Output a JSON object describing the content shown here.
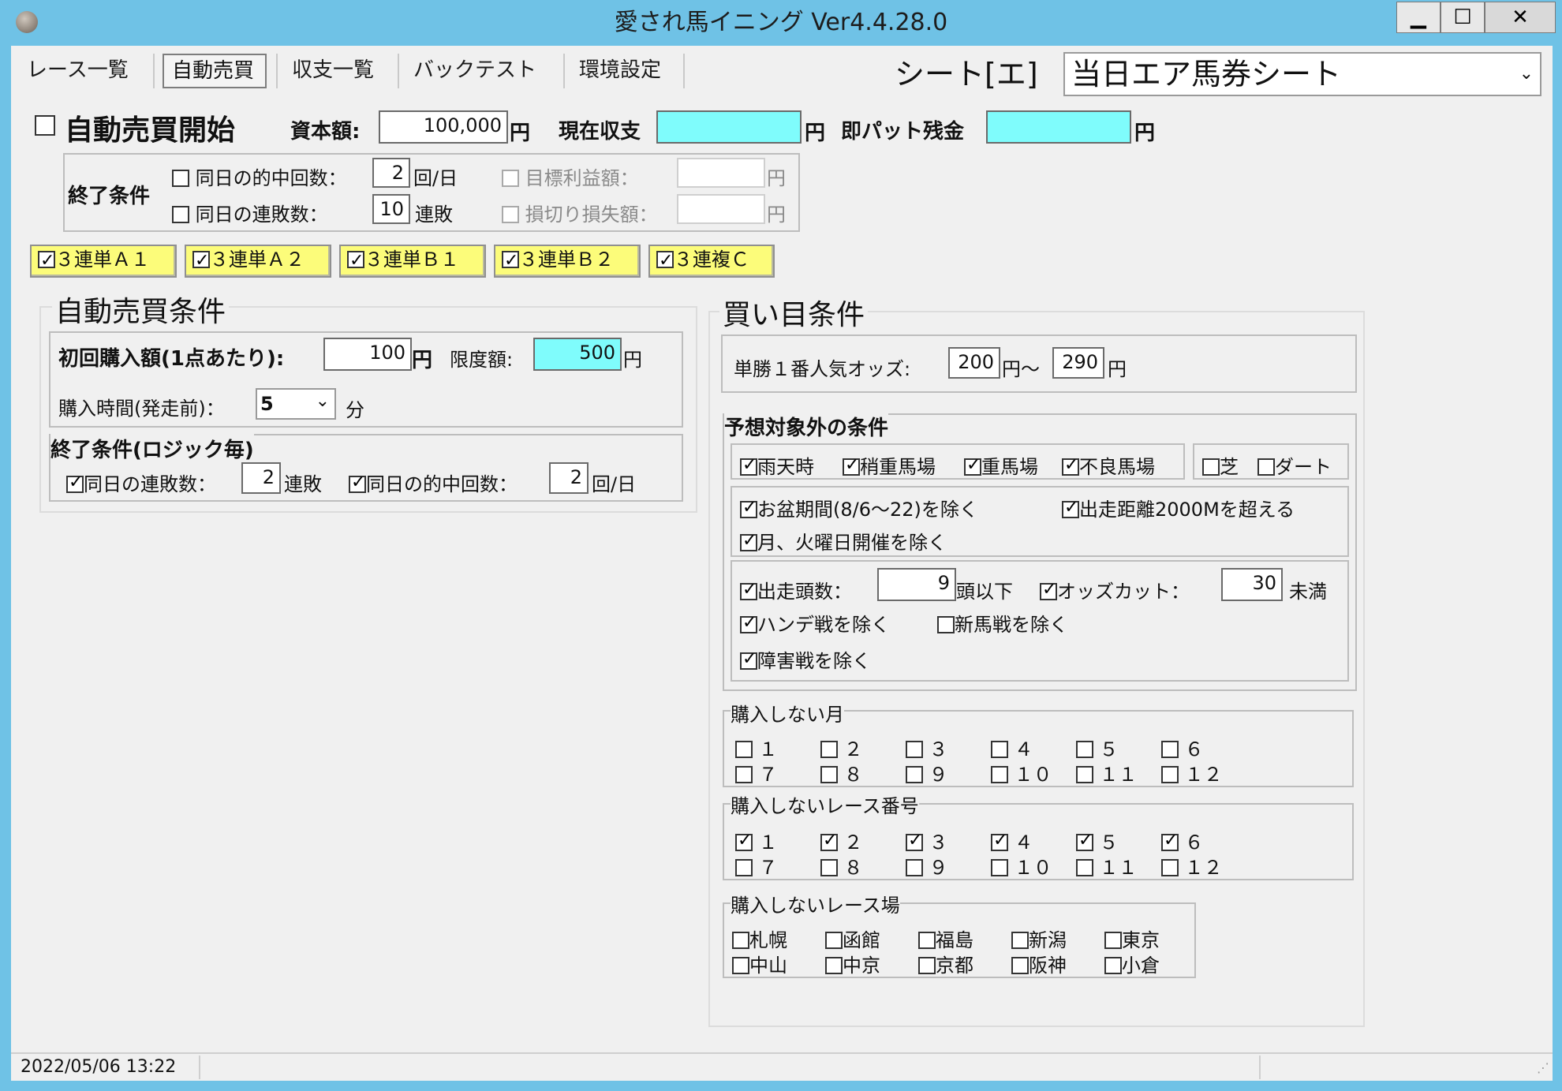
{
  "window": {
    "title": "愛され馬イニング Ver4.4.28.0",
    "minimize": "▁",
    "maximize": "☐",
    "close": "✕"
  },
  "menu": [
    "レース一覧",
    "自動売買",
    "収支一覧",
    "バックテスト",
    "環境設定"
  ],
  "sheet": {
    "label": "シート[エ]",
    "selected": "当日エア馬券シート"
  },
  "top": {
    "auto_start": "自動売買開始",
    "capital_label": "資本額:",
    "capital": "100,000",
    "yen": "円",
    "current_label": "現在収支",
    "current_value": "",
    "sokupat_label": "即パット残金",
    "sokupat_value": ""
  },
  "end_cond": {
    "title": "終了条件",
    "hit_label": "同日の的中回数：",
    "hit_value": "2",
    "hit_unit": "回/日",
    "loss_label": "同日の連敗数：",
    "loss_value": "10",
    "loss_unit": "連敗",
    "target_label": "目標利益額：",
    "stop_label": "損切り損失額：",
    "yen": "円"
  },
  "logic_tabs": [
    "３連単Ａ１",
    "３連単Ａ２",
    "３連単Ｂ１",
    "３連単Ｂ２",
    "３連複Ｃ"
  ],
  "auto_cond": {
    "title": "自動売買条件",
    "first_buy_label": "初回購入額(1点あたり):",
    "first_buy": "100",
    "yen": "円",
    "limit_label": "限度額:",
    "limit": "500",
    "time_label": "購入時間(発走前)：",
    "time_value": "5",
    "time_unit": "分",
    "end_title": "終了条件(ロジック毎)",
    "loss_label": "同日の連敗数：",
    "loss_value": "2",
    "loss_unit": "連敗",
    "hit_label": "同日の的中回数：",
    "hit_value": "2",
    "hit_unit": "回/日"
  },
  "buy_cond": {
    "title": "買い目条件",
    "odds_label": "単勝１番人気オッズ:",
    "odds_from": "200",
    "odds_mid": "円〜",
    "odds_to": "290",
    "yen": "円",
    "excl_title": "予想対象外の条件",
    "weather": [
      "雨天時",
      "稍重馬場",
      "重馬場",
      "不良馬場"
    ],
    "surface": [
      "芝",
      "ダート"
    ],
    "obon": "お盆期間(8/6〜22)を除く",
    "distance": "出走距離2000Mを超える",
    "monday": "月、火曜日開催を除く",
    "runners_label": "出走頭数：",
    "runners_value": "9",
    "runners_unit": "頭以下",
    "oddscut_label": "オッズカット：",
    "oddscut_value": "30",
    "oddscut_unit": "未満",
    "handicap": "ハンデ戦を除く",
    "newhorse": "新馬戦を除く",
    "obstacle": "障害戦を除く",
    "month_title": "購入しない月",
    "race_title": "購入しないレース番号",
    "numbers": [
      "１",
      "２",
      "３",
      "４",
      "５",
      "６",
      "７",
      "８",
      "９",
      "１０",
      "１１",
      "１２"
    ],
    "course_title": "購入しないレース場",
    "courses": [
      "札幌",
      "函館",
      "福島",
      "新潟",
      "東京",
      "中山",
      "中京",
      "京都",
      "阪神",
      "小倉"
    ]
  },
  "status": {
    "datetime": "2022/05/06 13:22"
  }
}
